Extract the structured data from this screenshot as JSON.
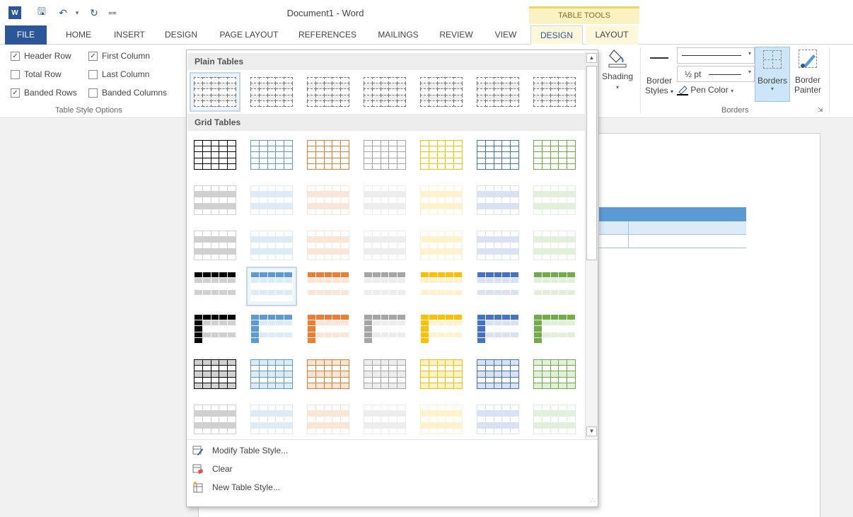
{
  "titlebar": {
    "title": "Document1 - Word",
    "context_label": "TABLE TOOLS"
  },
  "tabs": [
    {
      "label": "FILE"
    },
    {
      "label": "HOME"
    },
    {
      "label": "INSERT"
    },
    {
      "label": "DESIGN"
    },
    {
      "label": "PAGE LAYOUT"
    },
    {
      "label": "REFERENCES"
    },
    {
      "label": "MAILINGS"
    },
    {
      "label": "REVIEW"
    },
    {
      "label": "VIEW"
    },
    {
      "label": "DESIGN"
    },
    {
      "label": "LAYOUT"
    }
  ],
  "style_options": {
    "header_row": "Header Row",
    "first_column": "First Column",
    "total_row": "Total Row",
    "last_column": "Last Column",
    "banded_rows": "Banded Rows",
    "banded_columns": "Banded Columns",
    "group_label": "Table Style Options",
    "checked": {
      "header_row": true,
      "first_column": true,
      "total_row": false,
      "last_column": false,
      "banded_rows": true,
      "banded_columns": false
    }
  },
  "borders": {
    "shading": "Shading",
    "border_styles_1": "Border",
    "border_styles_2": "Styles",
    "weight": "½ pt",
    "pen_color": "Pen Color",
    "borders_btn": "Borders",
    "painter_1": "Border",
    "painter_2": "Painter",
    "group_label": "Borders"
  },
  "gallery": {
    "plain_header": "Plain Tables",
    "grid_header": "Grid Tables",
    "colors": [
      "#000000",
      "#5b9bd5",
      "#ed7d31",
      "#a5a5a5",
      "#ffc000",
      "#4472c4",
      "#70ad47"
    ],
    "light": [
      "#d0d0d0",
      "#ddebf7",
      "#fbe5d6",
      "#ededed",
      "#fff2cc",
      "#d9e2f3",
      "#e2efda"
    ],
    "menu": {
      "modify": "Modify Table Style...",
      "clear": "Clear",
      "new": "New Table Style..."
    }
  }
}
